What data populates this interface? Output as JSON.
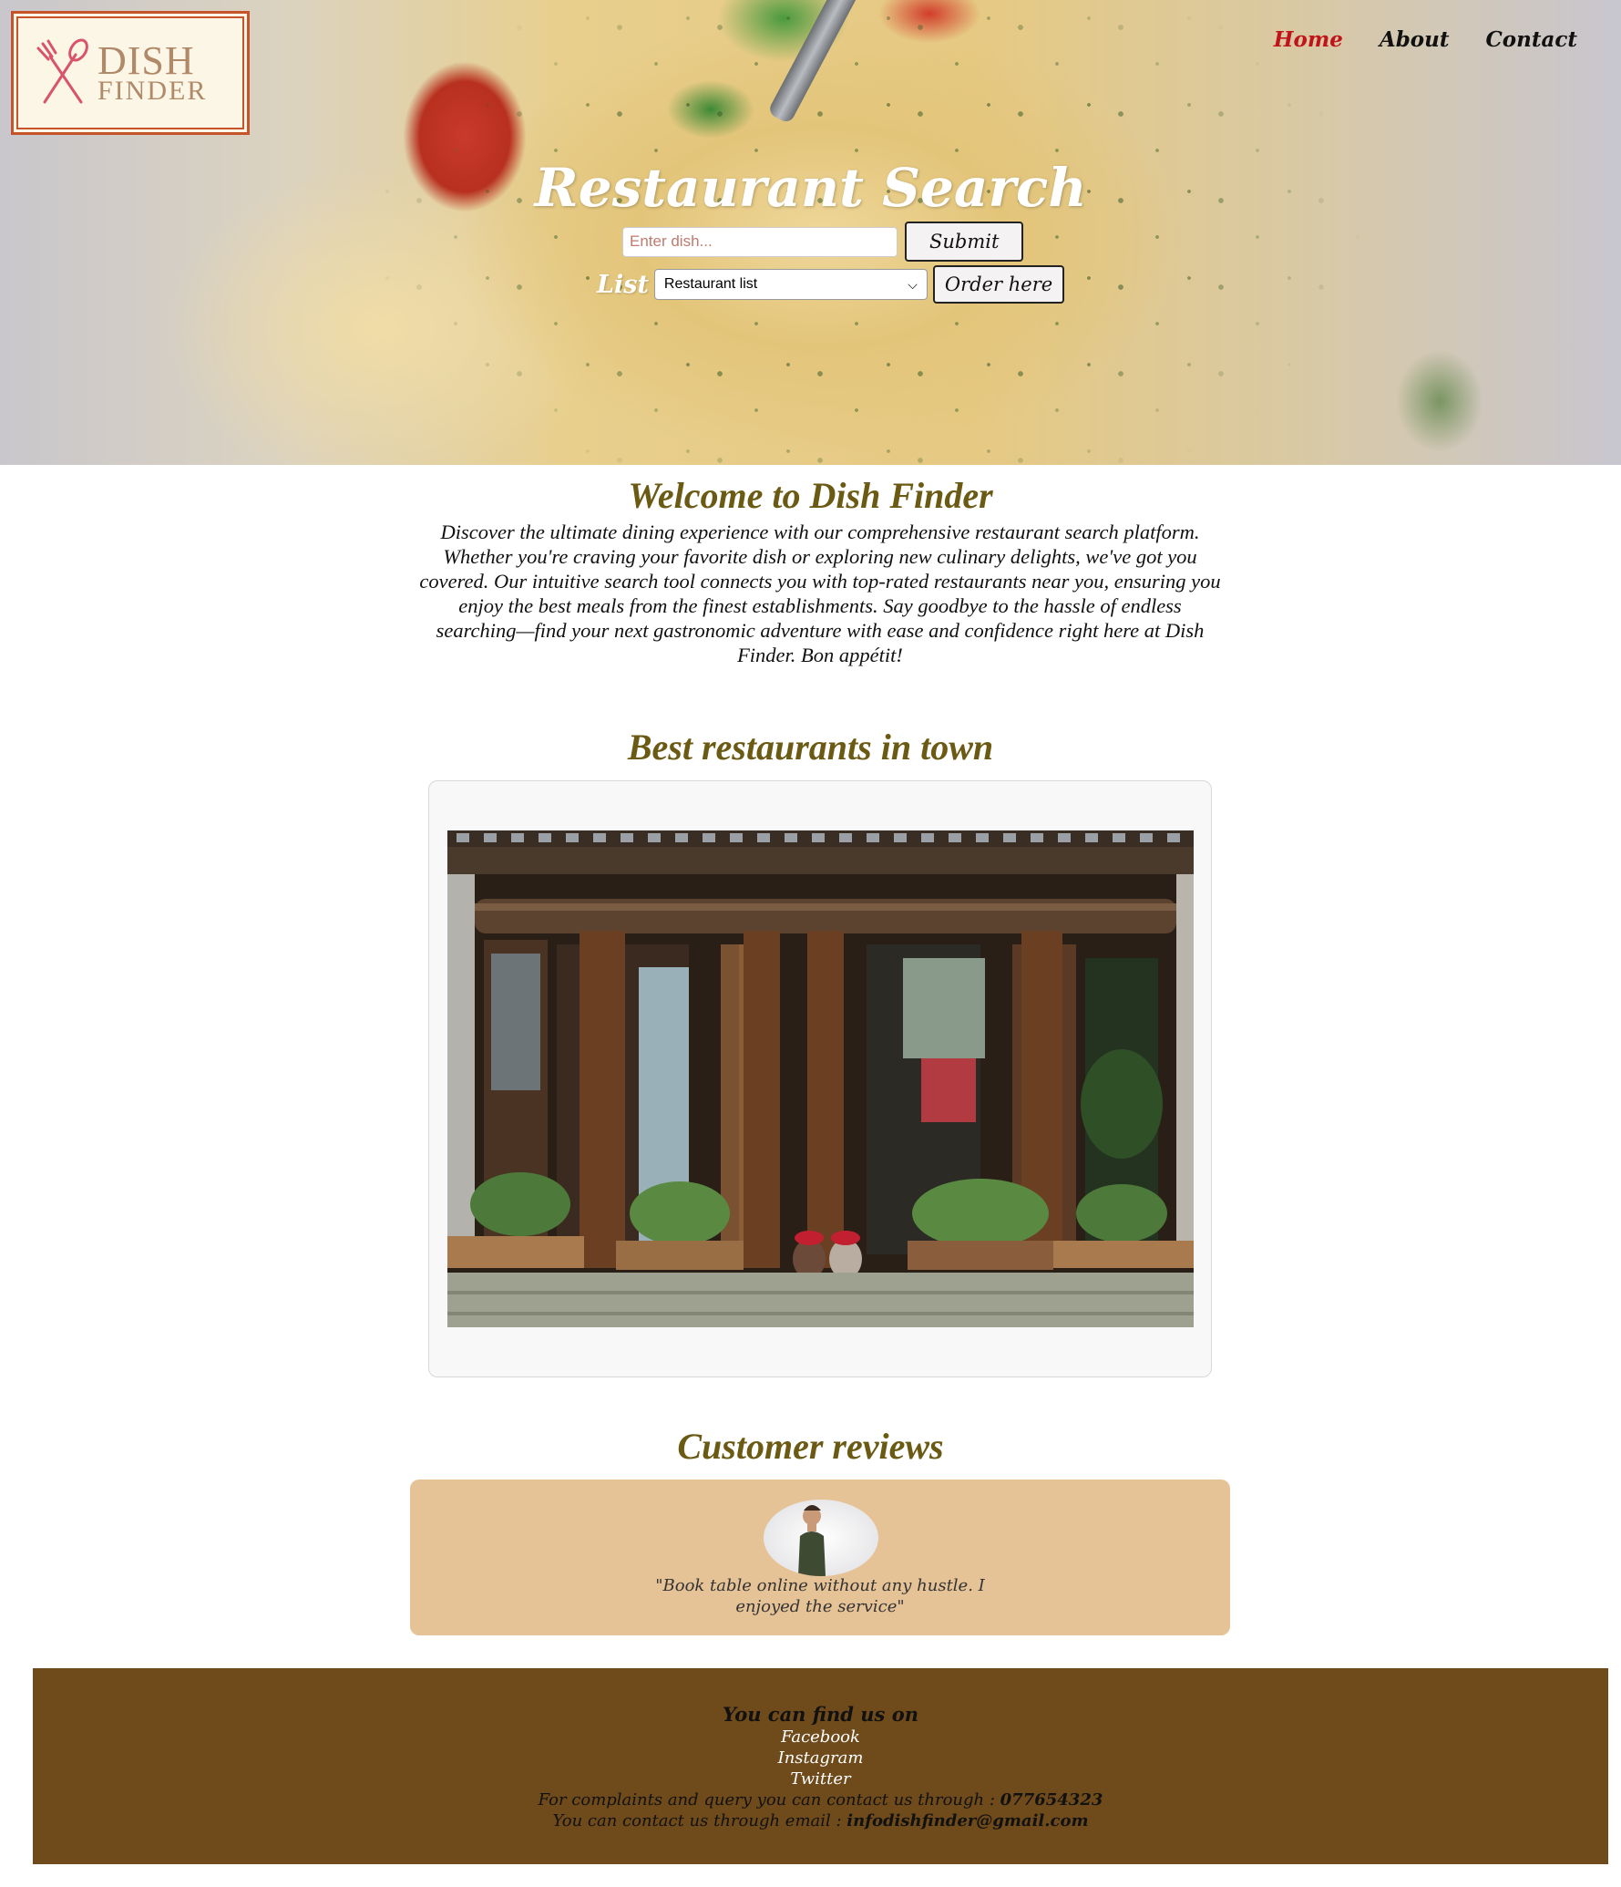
{
  "logo": {
    "line1": "DISH",
    "line2": "FINDER"
  },
  "nav": [
    {
      "label": "Home",
      "active": true
    },
    {
      "label": "About",
      "active": false
    },
    {
      "label": "Contact",
      "active": false
    }
  ],
  "hero": {
    "title": "Restaurant Search",
    "search_placeholder": "Enter dish...",
    "submit_label": "Submit",
    "list_label": "List",
    "select_value": "Restaurant list",
    "order_label": "Order here"
  },
  "welcome": {
    "title": "Welcome to Dish Finder",
    "text": "Discover the ultimate dining experience with our comprehensive restaurant search platform. Whether you're craving your favorite dish or exploring new culinary delights, we've got you covered. Our intuitive search tool connects you with top-rated restaurants near you, ensuring you enjoy the best meals from the finest establishments. Say goodbye to the hassle of endless searching—find your next gastronomic adventure with ease and confidence right here at Dish Finder. Bon appétit!"
  },
  "best": {
    "title": "Best restaurants in town"
  },
  "reviews": {
    "title": "Customer reviews",
    "quote": "\"Book table online without any hustle. I enjoyed the service\""
  },
  "footer": {
    "title": "You can find us on",
    "links": [
      "Facebook",
      "Instagram",
      "Twitter"
    ],
    "complaints_prefix": "For complaints and query you can contact us through : ",
    "phone": "077654323",
    "email_prefix": "You can contact us through email : ",
    "email": "infodishfinder@gmail.com"
  },
  "colors": {
    "accent_nav": "#c0141a",
    "heading": "#6b5a13",
    "review_bg": "#e6c396",
    "footer_bg": "#6f4a1b"
  }
}
